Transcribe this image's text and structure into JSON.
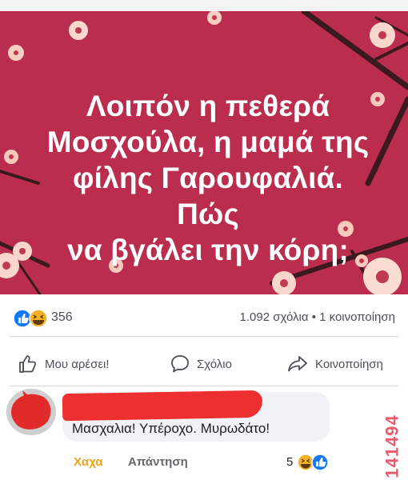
{
  "post": {
    "image_text_lines": [
      "Λοιπόν η πεθερά",
      "Μοσχούλα, η μαμά της",
      "φίλης Γαρουφαλιά. Πώς",
      "να βγάλει την κόρη;"
    ],
    "image_background_color": "#bb2d4e"
  },
  "stats": {
    "reaction_icons": [
      "like-icon",
      "haha-icon"
    ],
    "reaction_count": "356",
    "comments_shares": "1.092 σχόλια • 1 κοινοποίηση"
  },
  "actions": {
    "like_label": "Μου αρέσει!",
    "comment_label": "Σχόλιο",
    "share_label": "Κοινοποίηση"
  },
  "comment": {
    "text": "Μασχαλια! Υπέροχο. Μυρωδάτο!",
    "haha_label": "Χαχα",
    "reply_label": "Απάντηση",
    "reaction_count": "5",
    "reaction_icons": [
      "haha-icon",
      "like-icon"
    ]
  },
  "watermark": "141494",
  "colors": {
    "facebook_blue": "#1877f2",
    "haha_yellow": "#f7b125",
    "redaction_red": "#ee2f2f"
  }
}
